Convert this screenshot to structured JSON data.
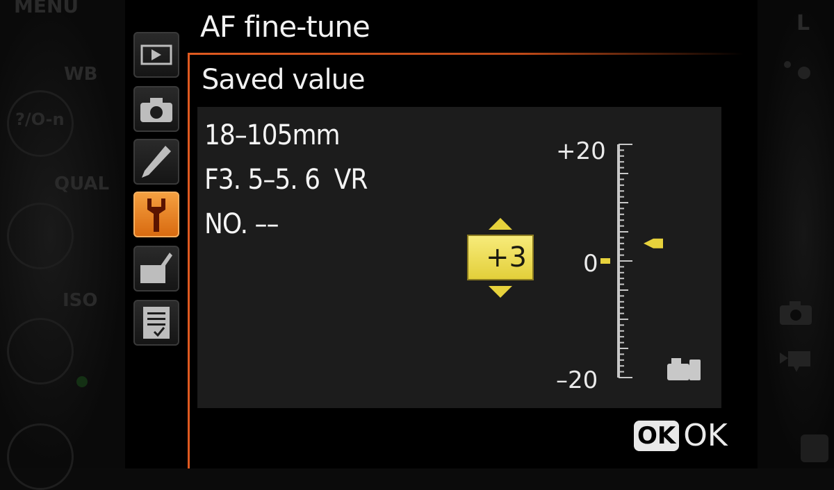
{
  "body_labels": {
    "menu": "MENU",
    "wb": "WB",
    "qual": "QUAL",
    "iso": "ISO",
    "lock": "?/O-n",
    "mode": "L"
  },
  "screen": {
    "title": "AF fine-tune",
    "subtitle": "Saved value"
  },
  "menu_tabs": [
    {
      "name": "playback-menu",
      "icon": "playback-icon",
      "active": false
    },
    {
      "name": "shooting-menu",
      "icon": "camera-icon",
      "active": false
    },
    {
      "name": "custom-settings-menu",
      "icon": "pencil-icon",
      "active": false
    },
    {
      "name": "setup-menu",
      "icon": "wrench-icon",
      "active": true
    },
    {
      "name": "retouch-menu",
      "icon": "retouch-brush-icon",
      "active": false
    },
    {
      "name": "recent-settings-menu",
      "icon": "checklist-icon",
      "active": false
    }
  ],
  "lens": {
    "line1": "18–105mm",
    "line2": "F3. 5–5. 6  VR",
    "line3": "NO. ––"
  },
  "adjust": {
    "value": "+3",
    "value_numeric": 3,
    "scale_max": "+20",
    "scale_zero": "0",
    "scale_min": "–20",
    "range": [
      -20,
      20
    ]
  },
  "footer": {
    "ok_badge": "OK",
    "ok_label": "OK"
  },
  "colors": {
    "accent_orange": "#e05a20",
    "highlight_yellow": "#e7d23c",
    "panel_bg": "#1c1c1c"
  }
}
